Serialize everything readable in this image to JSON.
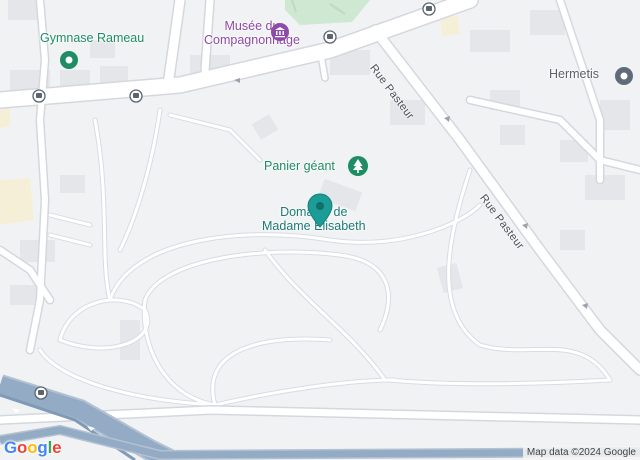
{
  "map": {
    "places": {
      "gymnase": {
        "name": "Gymnase Rameau",
        "icon": "landmark-pin-icon"
      },
      "musee": {
        "name_line1": "Musée du",
        "name_line2": "Compagnonnage",
        "icon": "museum-icon"
      },
      "hermetis": {
        "name": "Hermetis",
        "icon": "shop-icon"
      },
      "panier": {
        "name": "Panier géant",
        "icon": "tree-icon"
      },
      "domaine": {
        "name_line1": "Domaine de",
        "name_line2": "Madame Élisabeth",
        "icon": "location-pin-icon"
      }
    },
    "streets": {
      "pasteur_north": "Rue Pasteur",
      "pasteur_south": "Rue Pasteur"
    },
    "attribution": "Map data ©2024 Google",
    "logo": "Google",
    "colors": {
      "background": "#f1f2f4",
      "road": "#ffffff",
      "road_casing": "#d4d8de",
      "railway": "#8da6c0",
      "park": "#cfe8d2",
      "poi_green": "#1e8d63",
      "poi_purple": "#8e4aa8",
      "pin_teal": "#1c9c96"
    }
  }
}
